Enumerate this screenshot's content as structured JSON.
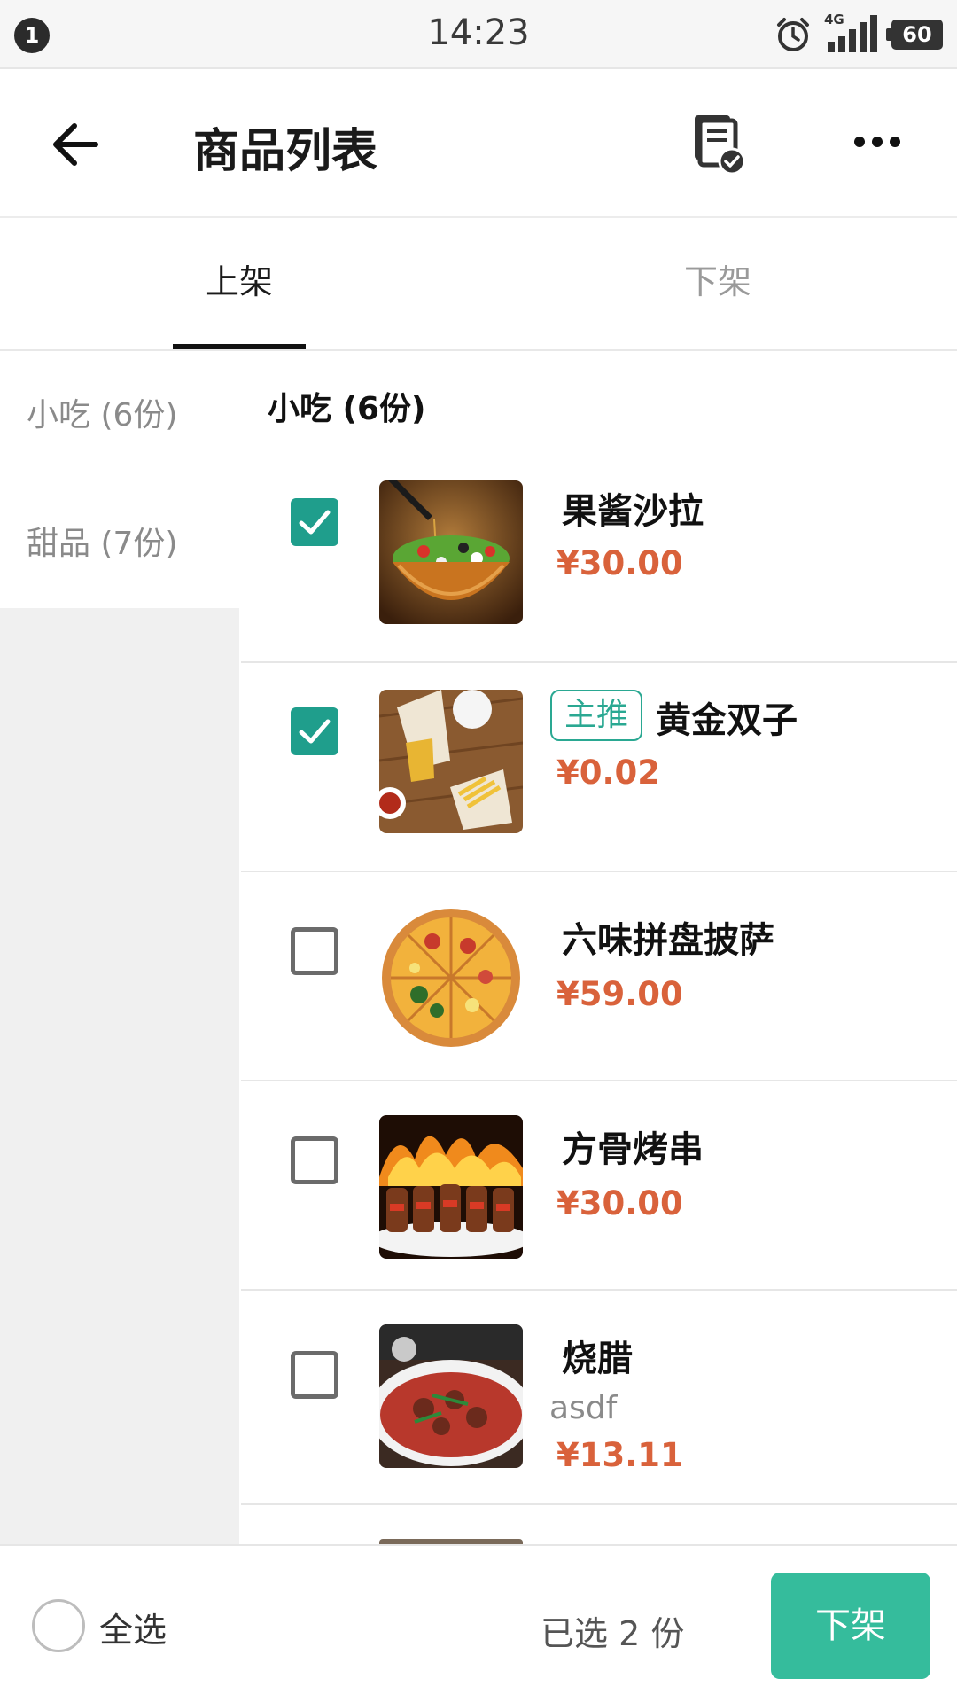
{
  "status_bar": {
    "notification_count": "1",
    "time": "14:23",
    "network": "4G",
    "battery": "60",
    "icons": [
      "alarm-icon",
      "signal-icon",
      "battery-icon"
    ]
  },
  "header": {
    "title": "商品列表",
    "icons": [
      "back-arrow-icon",
      "document-check-icon",
      "more-dots-icon"
    ]
  },
  "tabs": [
    {
      "label": "上架",
      "active": true
    },
    {
      "label": "下架",
      "active": false
    }
  ],
  "categories": [
    {
      "label": "小吃 (6份)"
    },
    {
      "label": "甜品 (7份)"
    }
  ],
  "section": {
    "title": "小吃 (6份)"
  },
  "items": [
    {
      "name": "果酱沙拉",
      "price": "¥30.00",
      "checked": true,
      "image": "salad"
    },
    {
      "name": "黄金双子",
      "tag": "主推",
      "price": "¥0.02",
      "checked": true,
      "image": "fries"
    },
    {
      "name": "六味拼盘披萨",
      "price": "¥59.00",
      "checked": false,
      "image": "pizza"
    },
    {
      "name": "方骨烤串",
      "price": "¥30.00",
      "checked": false,
      "image": "skewers"
    },
    {
      "name": "烧腊",
      "desc": "asdf",
      "price": "¥13.11",
      "checked": false,
      "image": "roast"
    }
  ],
  "bottom_bar": {
    "select_all": "全选",
    "selected_text": "已选 2 份",
    "action_button": "下架"
  },
  "colors": {
    "accent": "#1f9e8c",
    "button": "#35bc9c",
    "price": "#d9623b"
  }
}
